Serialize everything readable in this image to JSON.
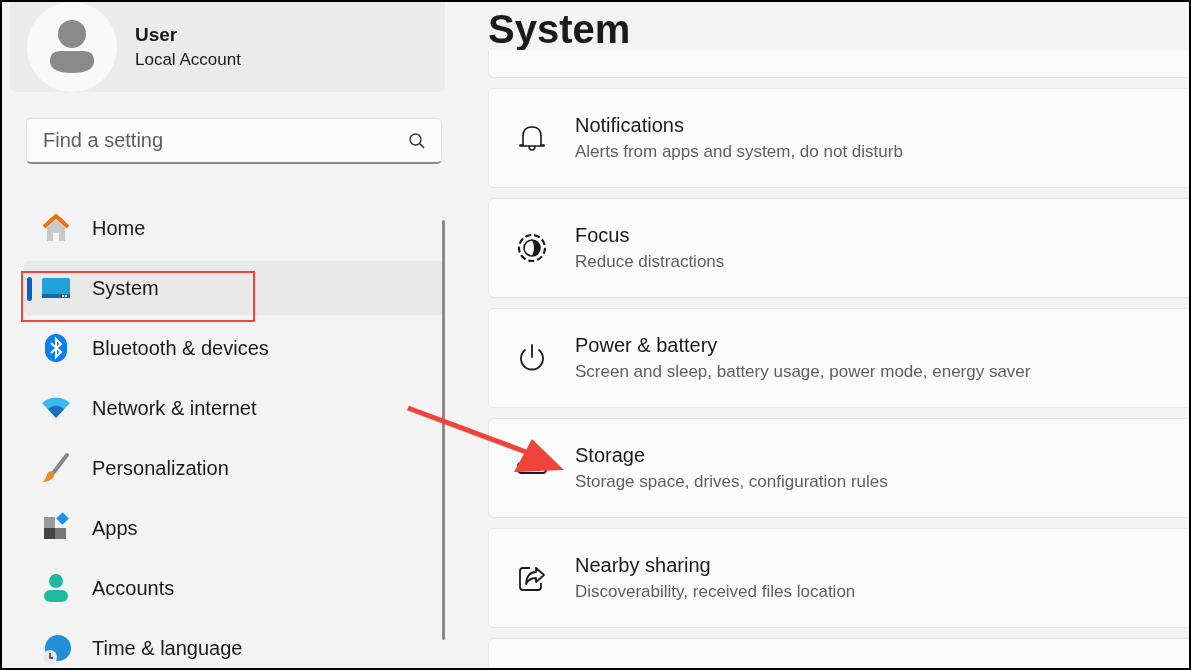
{
  "profile": {
    "name": "User",
    "account": "Local Account"
  },
  "search": {
    "placeholder": "Find a setting"
  },
  "nav": [
    {
      "label": "Home",
      "selected": false
    },
    {
      "label": "System",
      "selected": true
    },
    {
      "label": "Bluetooth & devices",
      "selected": false
    },
    {
      "label": "Network & internet",
      "selected": false
    },
    {
      "label": "Personalization",
      "selected": false
    },
    {
      "label": "Apps",
      "selected": false
    },
    {
      "label": "Accounts",
      "selected": false
    },
    {
      "label": "Time & language",
      "selected": false
    }
  ],
  "page_title": "System",
  "cards": [
    {
      "title": "Notifications",
      "subtitle": "Alerts from apps and system, do not disturb"
    },
    {
      "title": "Focus",
      "subtitle": "Reduce distractions"
    },
    {
      "title": "Power & battery",
      "subtitle": "Screen and sleep, battery usage, power mode, energy saver"
    },
    {
      "title": "Storage",
      "subtitle": "Storage space, drives, configuration rules"
    },
    {
      "title": "Nearby sharing",
      "subtitle": "Discoverability, received files location"
    }
  ]
}
